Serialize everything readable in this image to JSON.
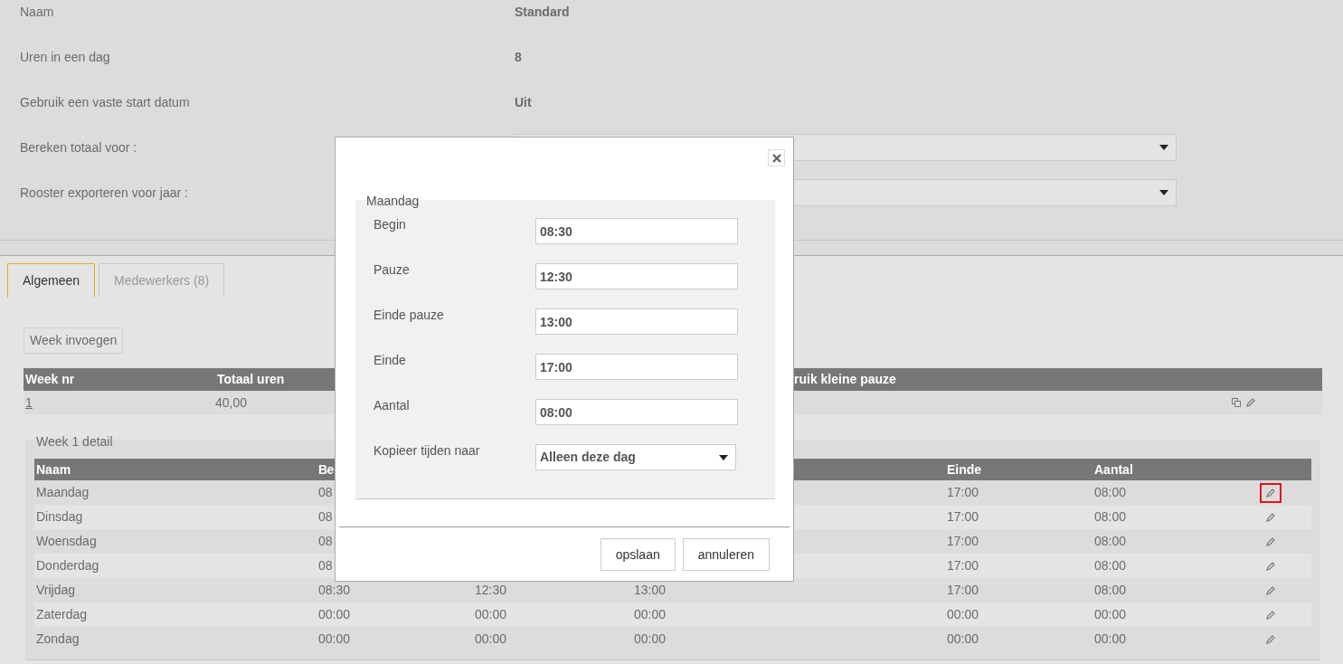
{
  "settings": [
    {
      "label": "Naam",
      "kind": "text",
      "value": "Standard"
    },
    {
      "label": "Uren in een dag",
      "kind": "text",
      "value": "8"
    },
    {
      "label": "Gebruik een vaste start datum",
      "kind": "text",
      "value": "Uit"
    },
    {
      "label": "Bereken totaal voor :",
      "kind": "select"
    },
    {
      "label": "Rooster exporteren voor jaar :",
      "kind": "select"
    }
  ],
  "tabs": [
    {
      "label": "Algemeen",
      "selected": true
    },
    {
      "label": "Medewerkers (8)",
      "selected": false
    }
  ],
  "insert_button": "Week invoegen",
  "weeks_table": {
    "columns": [
      "Week nr",
      "Totaal uren",
      "ruik kleine pauze"
    ],
    "rows": [
      {
        "week_nr": "1",
        "total_hours": "40,00"
      }
    ]
  },
  "detail": {
    "title": "Week 1 detail",
    "columns": [
      "Naam",
      "Be",
      "Einde",
      "Aantal"
    ],
    "rows": [
      {
        "name": "Maandag",
        "begin": "08",
        "end": "17:00",
        "count": "08:00",
        "highlighted": true
      },
      {
        "name": "Dinsdag",
        "begin": "08",
        "end": "17:00",
        "count": "08:00",
        "highlighted": false
      },
      {
        "name": "Woensdag",
        "begin": "08",
        "end": "17:00",
        "count": "08:00",
        "highlighted": false
      },
      {
        "name": "Donderdag",
        "begin": "08",
        "end": "17:00",
        "count": "08:00",
        "highlighted": false
      },
      {
        "name": "Vrijdag",
        "begin": "08:30",
        "pause": "12:30",
        "pause_end": "13:00",
        "end": "17:00",
        "count": "08:00",
        "highlighted": false
      },
      {
        "name": "Zaterdag",
        "begin": "00:00",
        "pause": "00:00",
        "pause_end": "00:00",
        "end": "00:00",
        "count": "00:00",
        "highlighted": false
      },
      {
        "name": "Zondag",
        "begin": "00:00",
        "pause": "00:00",
        "pause_end": "00:00",
        "end": "00:00",
        "count": "00:00",
        "highlighted": false
      }
    ]
  },
  "dialog": {
    "legend": "Maandag",
    "fields": [
      {
        "label": "Begin",
        "kind": "input",
        "value": "08:30"
      },
      {
        "label": "Pauze",
        "kind": "input",
        "value": "12:30"
      },
      {
        "label": "Einde pauze",
        "kind": "input",
        "value": "13:00"
      },
      {
        "label": "Einde",
        "kind": "input",
        "value": "17:00"
      },
      {
        "label": "Aantal",
        "kind": "input",
        "value": "08:00"
      },
      {
        "label": "Kopieer tijden naar",
        "kind": "select",
        "value": "Alleen deze dag"
      }
    ],
    "buttons": [
      "opslaan",
      "annuleren"
    ]
  }
}
